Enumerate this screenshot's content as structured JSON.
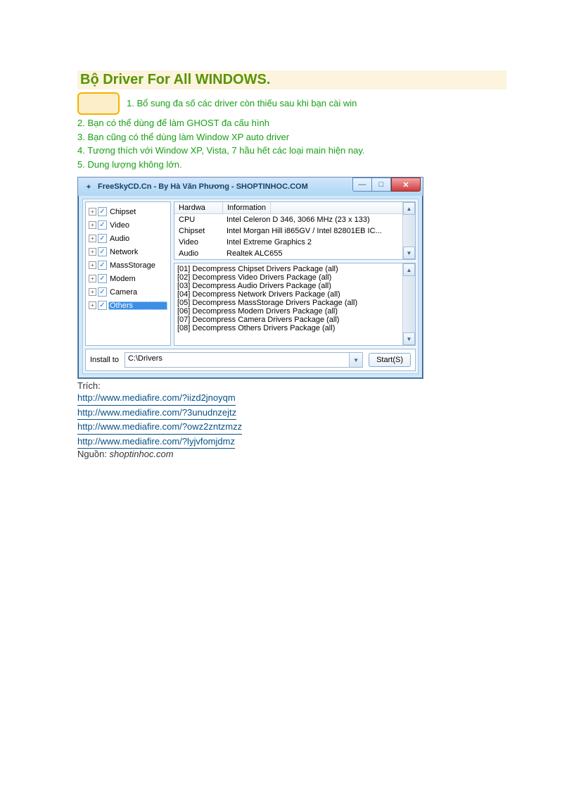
{
  "title": "Bộ Driver For All WINDOWS.",
  "intro": {
    "l1": "1. Bổ sung đa số các driver còn thiếu sau khi bạn cài win",
    "l2": "2. Bạn có thể dùng để làm GHOST đa cấu hình",
    "l3": "3. Bạn cũng có thể dùng làm Window XP auto driver",
    "l4": "4. Tương thích với Window XP, Vista, 7 hầu hết các loại main hiện nay.",
    "l5": "5. Dung lượng không lớn."
  },
  "window": {
    "title": "FreeSkyCD.Cn - By Hà Văn Phương - SHOPTINHOC.COM",
    "tree": [
      {
        "label": "Chipset",
        "checked": true,
        "selected": false
      },
      {
        "label": "Video",
        "checked": true,
        "selected": false
      },
      {
        "label": "Audio",
        "checked": true,
        "selected": false
      },
      {
        "label": "Network",
        "checked": true,
        "selected": false
      },
      {
        "label": "MassStorage",
        "checked": true,
        "selected": false
      },
      {
        "label": "Modem",
        "checked": true,
        "selected": false
      },
      {
        "label": "Camera",
        "checked": true,
        "selected": false
      },
      {
        "label": "Others",
        "checked": true,
        "selected": true
      }
    ],
    "hw_header": {
      "c1": "Hardwa",
      "c2": "Information"
    },
    "hw_rows": [
      {
        "c1": "CPU",
        "c2": "Intel Celeron D 346, 3066 MHz (23 x 133)"
      },
      {
        "c1": "Chipset",
        "c2": "Intel Morgan Hill i865GV / Intel 82801EB IC..."
      },
      {
        "c1": "Video",
        "c2": "Intel Extreme Graphics 2"
      },
      {
        "c1": "Audio",
        "c2": "Realtek ALC655"
      }
    ],
    "log": [
      "[01] Decompress Chipset Drivers Package (all)",
      "[02] Decompress Video Drivers Package (all)",
      "[03] Decompress Audio Drivers Package (all)",
      "[04] Decompress Network Drivers Package (all)",
      "[05] Decompress MassStorage Drivers Package (all)",
      "[06] Decompress Modem Drivers Package (all)",
      "[07] Decompress Camera Drivers Package (all)",
      "[08] Decompress Others Drivers Package (all)"
    ],
    "install_label": "Install to",
    "install_path": "C:\\Drivers",
    "start_label": "Start(S)"
  },
  "footer": {
    "trich": "Trích:",
    "links": [
      "http://www.mediafire.com/?iizd2jnoyqm",
      "http://www.mediafire.com/?3unudnzejtz",
      "http://www.mediafire.com/?owz2zntzmzz",
      "http://www.mediafire.com/?lyjvfomjdmz"
    ],
    "nguon_label": "Nguồn: ",
    "nguon_value": "shoptinhoc.com"
  }
}
